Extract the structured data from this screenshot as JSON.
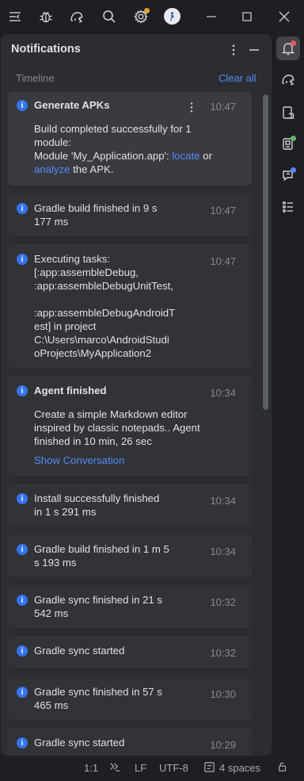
{
  "toolbar": {
    "icons": [
      "hide-panel-icon",
      "bug-icon",
      "gradle-elephant-icon",
      "search-icon",
      "settings-icon"
    ],
    "window_buttons": [
      "minimize",
      "maximize",
      "close"
    ]
  },
  "panel": {
    "title": "Notifications",
    "timeline_label": "Timeline",
    "clear_all": "Clear all"
  },
  "notifications": [
    {
      "title": "Generate APKs",
      "time": "10:47",
      "body_prefix": "Build completed successfully for 1\nmodule:\nModule 'My_Application.app': ",
      "link1": "locate",
      "mid": " or\n",
      "link2": "analyze",
      "suffix": " the APK."
    },
    {
      "text": "Gradle build finished in 9 s\n177 ms",
      "time": "10:47"
    },
    {
      "text": "Executing tasks:\n[:app:assembleDebug,\n:app:assembleDebugUnitTest,\n\n:app:assembleDebugAndroidT\nest] in project\nC:\\Users\\marco\\AndroidStudi\noProjects\\MyApplication2",
      "time": "10:47"
    },
    {
      "title": "Agent finished",
      "time": "10:34",
      "body": "Create a simple Markdown editor\ninspired by classic notepads.. Agent\nfinished in 10 min, 26 sec",
      "action": "Show Conversation"
    },
    {
      "text": "Install successfully finished\nin 1 s 291 ms",
      "time": "10:34"
    },
    {
      "text": "Gradle build finished in 1 m 5\ns 193 ms",
      "time": "10:34"
    },
    {
      "text": "Gradle sync finished in 21 s\n542 ms",
      "time": "10:32"
    },
    {
      "text": "Gradle sync started",
      "time": "10:32"
    },
    {
      "text": "Gradle sync finished in 57 s\n465 ms",
      "time": "10:30"
    },
    {
      "text": "Gradle sync started",
      "time": "10:29"
    }
  ],
  "statusbar": {
    "position": "1:1",
    "line_ending": "LF",
    "encoding": "UTF-8",
    "indent": "4 spaces"
  },
  "colors": {
    "accent": "#548af7",
    "info": "#3574f0",
    "notification_badge": "#e55765",
    "success_badge": "#5fb865"
  }
}
